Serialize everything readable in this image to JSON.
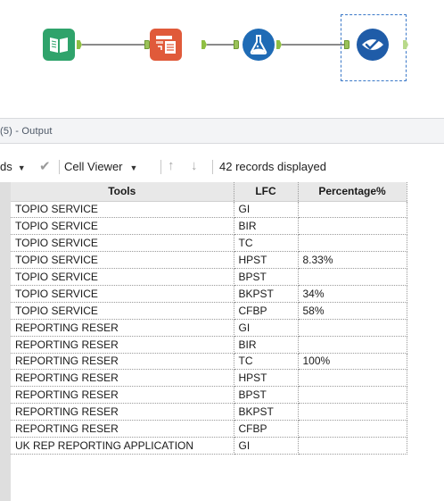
{
  "workflow": {
    "tools": [
      {
        "name": "input-data-tool",
        "icon": "book-icon",
        "color": "#2fa36b"
      },
      {
        "name": "select-tool",
        "icon": "table-select-icon",
        "color": "#e05a3a"
      },
      {
        "name": "formula-tool",
        "icon": "flask-icon",
        "color": "#1f6bb5"
      },
      {
        "name": "browse-tool",
        "icon": "check-eye-icon",
        "color": "#1f5ca8"
      }
    ]
  },
  "results": {
    "title": "(5) - Output"
  },
  "toolbar": {
    "fields_label": "ds",
    "cell_viewer_label": "Cell Viewer",
    "records_label": "42 records displayed"
  },
  "table": {
    "columns": [
      "Tools",
      "LFC",
      "Percentage%"
    ],
    "rows": [
      [
        "TOPIO SERVICE",
        "GI",
        ""
      ],
      [
        "TOPIO SERVICE",
        "BIR",
        ""
      ],
      [
        "TOPIO SERVICE",
        "TC",
        ""
      ],
      [
        "TOPIO SERVICE",
        "HPST",
        "8.33%"
      ],
      [
        "TOPIO SERVICE",
        "BPST",
        ""
      ],
      [
        "TOPIO SERVICE",
        "BKPST",
        "34%"
      ],
      [
        "TOPIO SERVICE",
        "CFBP",
        "58%"
      ],
      [
        "REPORTING RESER",
        "GI",
        ""
      ],
      [
        "REPORTING RESER",
        "BIR",
        ""
      ],
      [
        "REPORTING RESER",
        "TC",
        "100%"
      ],
      [
        "REPORTING RESER",
        "HPST",
        ""
      ],
      [
        "REPORTING RESER",
        "BPST",
        ""
      ],
      [
        "REPORTING RESER",
        "BKPST",
        ""
      ],
      [
        "REPORTING RESER",
        "CFBP",
        ""
      ],
      [
        "UK REP REPORTING APPLICATION",
        "GI",
        ""
      ]
    ]
  }
}
